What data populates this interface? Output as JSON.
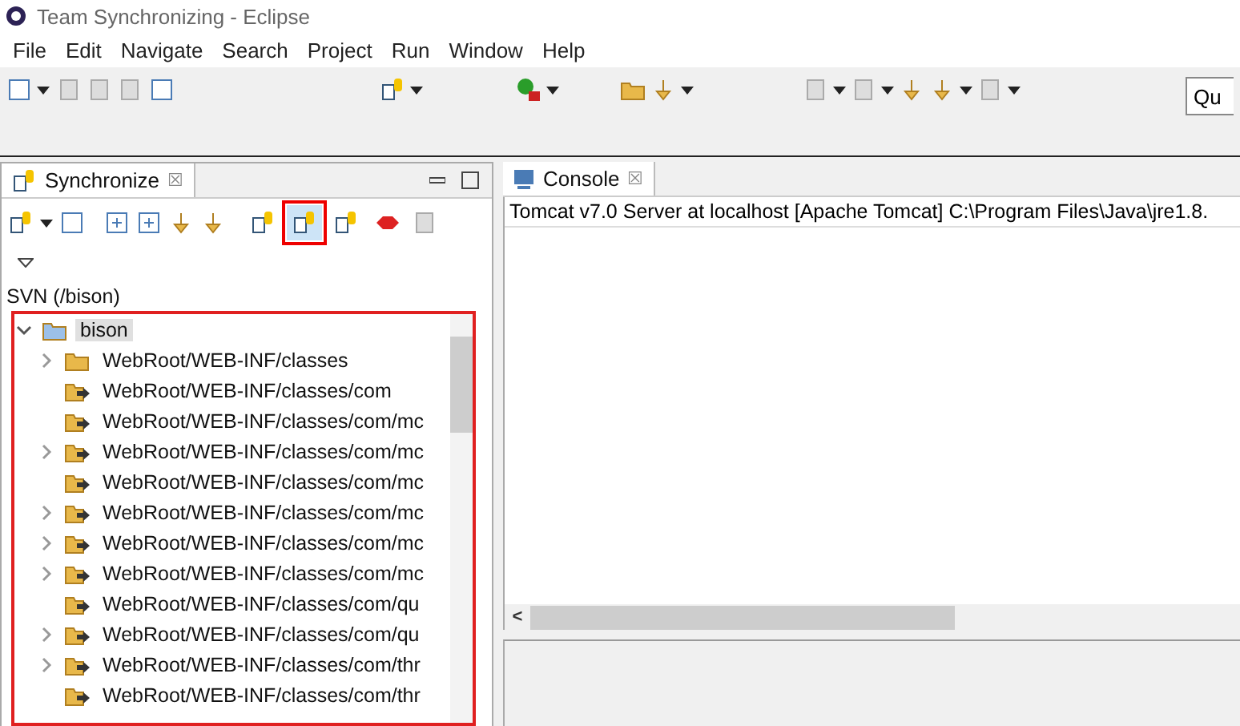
{
  "window": {
    "title": "Team Synchronizing - Eclipse"
  },
  "menu": [
    "File",
    "Edit",
    "Navigate",
    "Search",
    "Project",
    "Run",
    "Window",
    "Help"
  ],
  "quick_access": {
    "value": "Qu"
  },
  "synchronize_view": {
    "title": "Synchronize",
    "close": "☒",
    "modes": [
      {
        "selected": false
      },
      {
        "selected": true
      },
      {
        "selected": false
      },
      {
        "selected": false
      }
    ],
    "label": "SVN (/bison)",
    "tree": [
      {
        "label": "bison",
        "expanded": true,
        "selected": true,
        "children": [
          {
            "label": "WebRoot/WEB-INF/classes",
            "has_children": true,
            "kind": "folder"
          },
          {
            "label": "WebRoot/WEB-INF/classes/com",
            "has_children": false,
            "kind": "outgoing"
          },
          {
            "label": "WebRoot/WEB-INF/classes/com/mc",
            "has_children": false,
            "kind": "outgoing"
          },
          {
            "label": "WebRoot/WEB-INF/classes/com/mc",
            "has_children": true,
            "kind": "outgoing"
          },
          {
            "label": "WebRoot/WEB-INF/classes/com/mc",
            "has_children": false,
            "kind": "outgoing"
          },
          {
            "label": "WebRoot/WEB-INF/classes/com/mc",
            "has_children": true,
            "kind": "outgoing"
          },
          {
            "label": "WebRoot/WEB-INF/classes/com/mc",
            "has_children": true,
            "kind": "outgoing"
          },
          {
            "label": "WebRoot/WEB-INF/classes/com/mc",
            "has_children": true,
            "kind": "outgoing"
          },
          {
            "label": "WebRoot/WEB-INF/classes/com/qu",
            "has_children": false,
            "kind": "outgoing"
          },
          {
            "label": "WebRoot/WEB-INF/classes/com/qu",
            "has_children": true,
            "kind": "outgoing"
          },
          {
            "label": "WebRoot/WEB-INF/classes/com/thr",
            "has_children": true,
            "kind": "outgoing"
          },
          {
            "label": "WebRoot/WEB-INF/classes/com/thr",
            "has_children": false,
            "kind": "outgoing"
          }
        ]
      }
    ]
  },
  "console_view": {
    "title": "Console",
    "close": "☒",
    "scroll_left": "<",
    "text": "Tomcat v7.0 Server at localhost [Apache Tomcat] C:\\Program Files\\Java\\jre1.8."
  }
}
